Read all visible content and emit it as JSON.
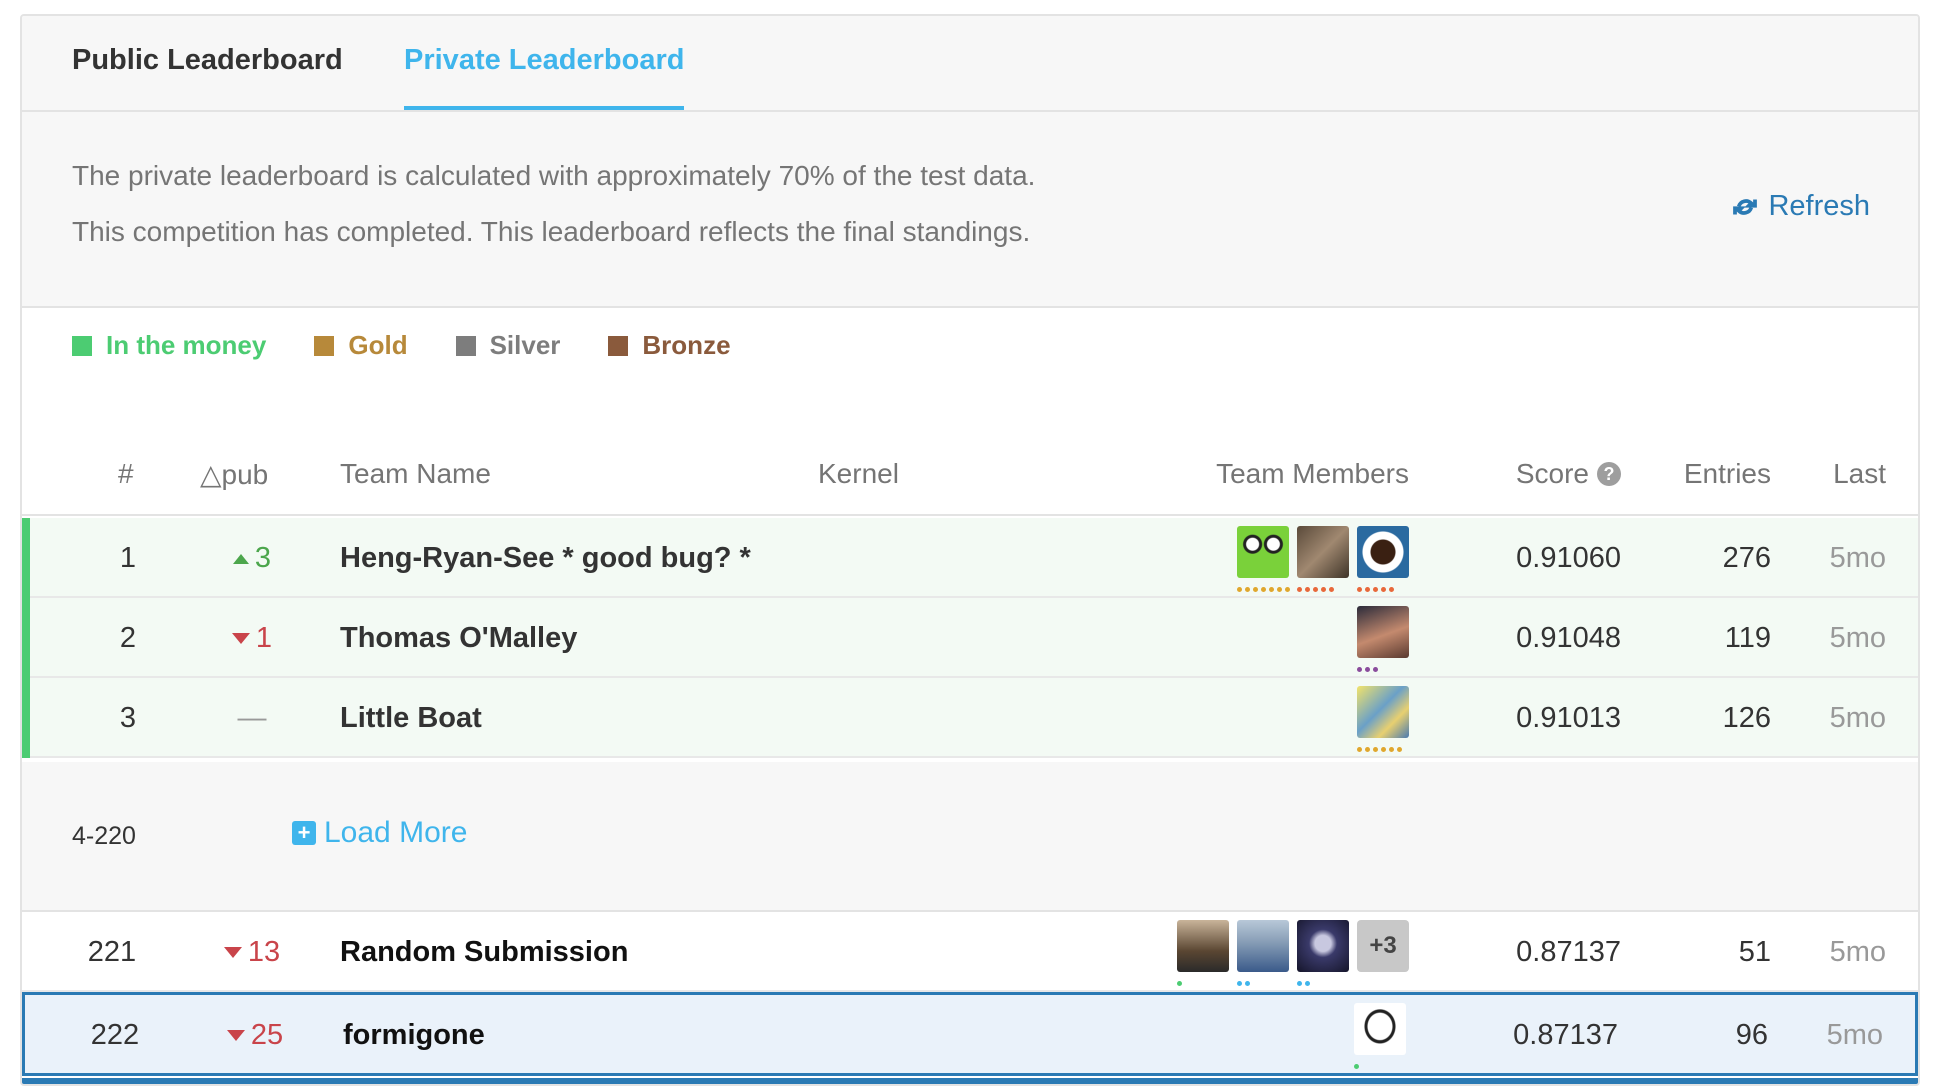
{
  "tabs": [
    {
      "label": "Public Leaderboard",
      "active": false
    },
    {
      "label": "Private Leaderboard",
      "active": true
    }
  ],
  "info": {
    "line1": "The private leaderboard is calculated with approximately 70% of the test data.",
    "line2": "This competition has completed. This leaderboard reflects the final standings.",
    "refresh_label": "Refresh"
  },
  "legend": [
    {
      "label": "In the money",
      "color": "#4ccc72"
    },
    {
      "label": "Gold",
      "color": "#b7893a"
    },
    {
      "label": "Silver",
      "color": "#7d7d7d"
    },
    {
      "label": "Bronze",
      "color": "#8a5a3c"
    }
  ],
  "columns": {
    "rank": "#",
    "delta": "△pub",
    "team": "Team Name",
    "kernel": "Kernel",
    "members": "Team Members",
    "score": "Score",
    "entries": "Entries",
    "last": "Last"
  },
  "rows": [
    {
      "rank": "1",
      "delta": "3",
      "direction": "up",
      "team": "Heng-Ryan-See * good bug? *",
      "score": "0.91060",
      "entries": "276",
      "last": "5mo"
    },
    {
      "rank": "2",
      "delta": "1",
      "direction": "down",
      "team": "Thomas O'Malley",
      "score": "0.91048",
      "entries": "119",
      "last": "5mo"
    },
    {
      "rank": "3",
      "delta": "—",
      "direction": "none",
      "team": "Little Boat",
      "score": "0.91013",
      "entries": "126",
      "last": "5mo"
    },
    {
      "rank": "221",
      "delta": "13",
      "direction": "down",
      "team": "Random Submission",
      "score": "0.87137",
      "entries": "51",
      "last": "5mo",
      "more_members": "+3"
    },
    {
      "rank": "222",
      "delta": "25",
      "direction": "down",
      "team": "formigone",
      "score": "0.87137",
      "entries": "96",
      "last": "5mo"
    }
  ],
  "band": {
    "range": "4-220",
    "load_more_label": "Load More"
  }
}
